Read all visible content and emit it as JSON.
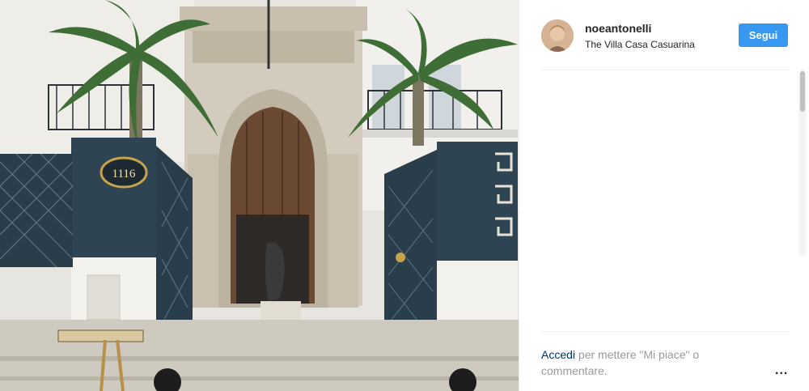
{
  "post": {
    "image_alt": "Villa entrance with palm trees and ornate gates",
    "house_number": "1116"
  },
  "header": {
    "username": "noeantonelli",
    "location": "The Villa Casa Casuarina",
    "follow_label": "Segui"
  },
  "footer": {
    "login_link": "Accedi",
    "login_text": " per mettere \"Mi piace\" o commentare.",
    "more_label": "..."
  },
  "colors": {
    "follow_button": "#3897f0",
    "link": "#003569"
  },
  "icons": {
    "more": "more-options-icon"
  }
}
